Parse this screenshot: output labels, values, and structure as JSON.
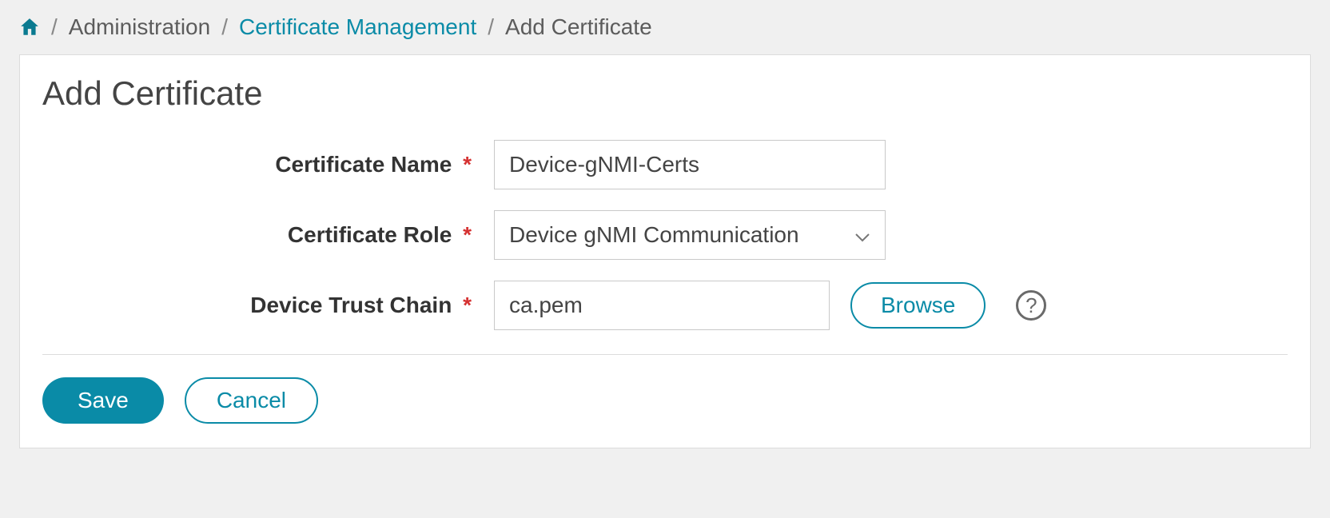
{
  "breadcrumb": {
    "items": [
      {
        "label": "Administration",
        "link": false
      },
      {
        "label": "Certificate Management",
        "link": true
      },
      {
        "label": "Add Certificate",
        "link": false
      }
    ]
  },
  "page": {
    "title": "Add Certificate"
  },
  "form": {
    "certificate_name": {
      "label": "Certificate Name",
      "required": true,
      "value": "Device-gNMI-Certs"
    },
    "certificate_role": {
      "label": "Certificate Role",
      "required": true,
      "value": "Device gNMI Communication"
    },
    "device_trust_chain": {
      "label": "Device Trust Chain",
      "required": true,
      "value": "ca.pem",
      "browse_label": "Browse"
    }
  },
  "actions": {
    "save": "Save",
    "cancel": "Cancel"
  },
  "required_marker": "*",
  "help_marker": "?"
}
